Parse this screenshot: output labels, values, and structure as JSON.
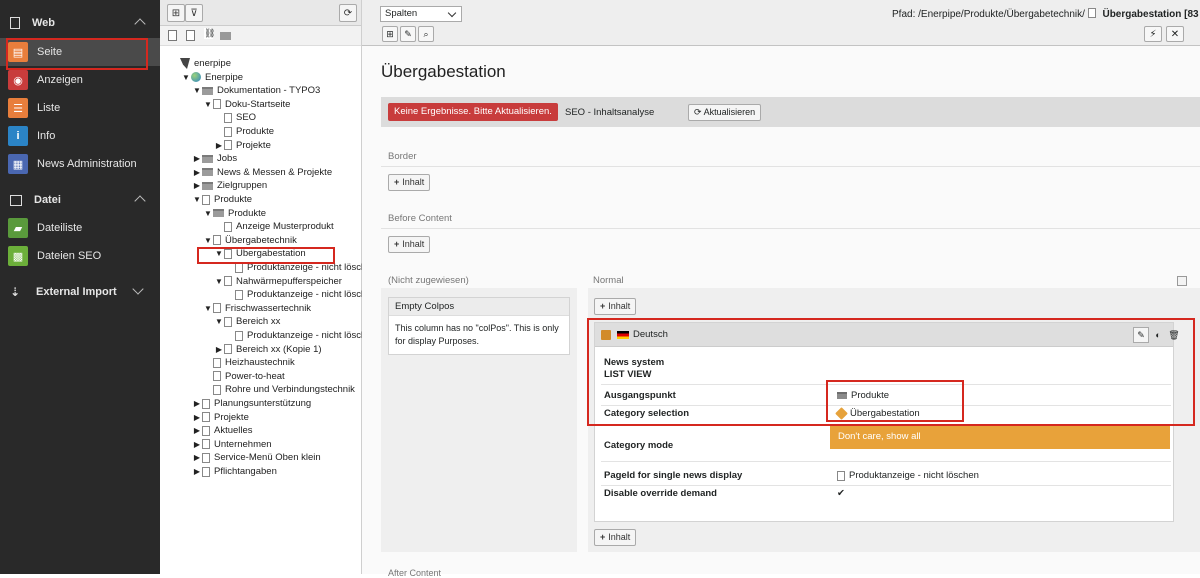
{
  "module_menu": {
    "groups": [
      {
        "label": "Web",
        "expanded": true
      },
      {
        "label": "Datei",
        "expanded": true
      },
      {
        "label": "External Import",
        "expanded": false
      }
    ],
    "items": [
      {
        "label": "Seite",
        "color": "#e87e3c",
        "glyph": "▤",
        "active": true
      },
      {
        "label": "Anzeigen",
        "color": "#c83c3c",
        "glyph": "◉"
      },
      {
        "label": "Liste",
        "color": "#e87e3c",
        "glyph": "☰"
      },
      {
        "label": "Info",
        "color": "#2b84c6",
        "glyph": "i"
      },
      {
        "label": "News Administration",
        "color": "#4a67b1",
        "glyph": "▦"
      },
      {
        "label": "Dateiliste",
        "color": "#5a9a3c",
        "glyph": "▰"
      },
      {
        "label": "Dateien SEO",
        "color": "#6caf3a",
        "glyph": "▩"
      }
    ]
  },
  "tree": {
    "nodes": [
      {
        "label": "enerpipe",
        "depth": 0,
        "type": "root",
        "toggle": ""
      },
      {
        "label": "Enerpipe",
        "depth": 1,
        "type": "globe",
        "toggle": "▼"
      },
      {
        "label": "Dokumentation - TYPO3",
        "depth": 2,
        "type": "folder",
        "toggle": "▼"
      },
      {
        "label": "Doku-Startseite",
        "depth": 3,
        "type": "page",
        "toggle": "▼"
      },
      {
        "label": "SEO",
        "depth": 4,
        "type": "page",
        "toggle": ""
      },
      {
        "label": "Produkte",
        "depth": 4,
        "type": "page",
        "toggle": ""
      },
      {
        "label": "Projekte",
        "depth": 4,
        "type": "page",
        "toggle": "▶"
      },
      {
        "label": "Jobs",
        "depth": 2,
        "type": "folder",
        "toggle": "▶"
      },
      {
        "label": "News & Messen & Projekte",
        "depth": 2,
        "type": "folder",
        "toggle": "▶"
      },
      {
        "label": "Zielgruppen",
        "depth": 2,
        "type": "folder",
        "toggle": "▶"
      },
      {
        "label": "Produkte",
        "depth": 2,
        "type": "page",
        "toggle": "▼"
      },
      {
        "label": "Produkte",
        "depth": 3,
        "type": "folder",
        "toggle": "▼"
      },
      {
        "label": "Anzeige Musterprodukt",
        "depth": 4,
        "type": "page",
        "toggle": ""
      },
      {
        "label": "Übergabetechnik",
        "depth": 3,
        "type": "page",
        "toggle": "▼"
      },
      {
        "label": "Übergabestation",
        "depth": 4,
        "type": "page",
        "toggle": "▼"
      },
      {
        "label": "Produktanzeige - nicht lösch",
        "depth": 5,
        "type": "page",
        "toggle": ""
      },
      {
        "label": "Nahwärmepufferspeicher",
        "depth": 4,
        "type": "page",
        "toggle": "▼"
      },
      {
        "label": "Produktanzeige - nicht lösch",
        "depth": 5,
        "type": "page",
        "toggle": ""
      },
      {
        "label": "Frischwassertechnik",
        "depth": 3,
        "type": "page",
        "toggle": "▼"
      },
      {
        "label": "Bereich xx",
        "depth": 4,
        "type": "page",
        "toggle": "▼"
      },
      {
        "label": "Produktanzeige - nicht lösch",
        "depth": 5,
        "type": "page",
        "toggle": ""
      },
      {
        "label": "Bereich xx (Kopie 1)",
        "depth": 4,
        "type": "page",
        "toggle": "▶"
      },
      {
        "label": "Heizhaustechnik",
        "depth": 3,
        "type": "page",
        "toggle": ""
      },
      {
        "label": "Power-to-heat",
        "depth": 3,
        "type": "page",
        "toggle": ""
      },
      {
        "label": "Rohre und Verbindungstechnik",
        "depth": 3,
        "type": "page",
        "toggle": ""
      },
      {
        "label": "Planungsunterstützung",
        "depth": 2,
        "type": "page",
        "toggle": "▶"
      },
      {
        "label": "Projekte",
        "depth": 2,
        "type": "page",
        "toggle": "▶"
      },
      {
        "label": "Aktuelles",
        "depth": 2,
        "type": "page",
        "toggle": "▶"
      },
      {
        "label": "Unternehmen",
        "depth": 2,
        "type": "page",
        "toggle": "▶"
      },
      {
        "label": "Service-Menü Oben klein",
        "depth": 2,
        "type": "page",
        "toggle": "▶"
      },
      {
        "label": "Pflichtangaben",
        "depth": 2,
        "type": "page",
        "toggle": "▶"
      }
    ]
  },
  "docheader": {
    "view_select": "Spalten",
    "path_prefix": "Pfad: /Enerpipe/Produkte/Übergabetechnik/",
    "path_current": "Übergabestation [83"
  },
  "content": {
    "title": "Übergabestation",
    "seo": {
      "error": "Keine Ergebnisse. Bitte Aktualisieren.",
      "label": "SEO - Inhaltsanalyse",
      "refresh": "Aktualisieren"
    },
    "sections": {
      "border": "Border",
      "before": "Before Content",
      "unassigned": "(Nicht zugewiesen)",
      "normal": "Normal",
      "after": "After Content"
    },
    "add_label": "Inhalt",
    "colpos": {
      "title": "Empty Colpos",
      "text": "This column has no \"colPos\". This is only for display Purposes."
    },
    "element": {
      "language": "Deutsch",
      "plugin_title": "News system",
      "plugin_sub": "LIST VIEW",
      "rows": {
        "ausgangspunkt": {
          "key": "Ausgangspunkt",
          "value": "Produkte"
        },
        "category": {
          "key": "Category selection",
          "value": "Übergabestation"
        },
        "mode": {
          "key": "Category mode",
          "value": "Don't care, show all"
        },
        "pageid": {
          "key": "PageId for single news display",
          "value": "Produktanzeige - nicht löschen"
        },
        "override": {
          "key": "Disable override demand",
          "value": "✔"
        }
      }
    }
  }
}
